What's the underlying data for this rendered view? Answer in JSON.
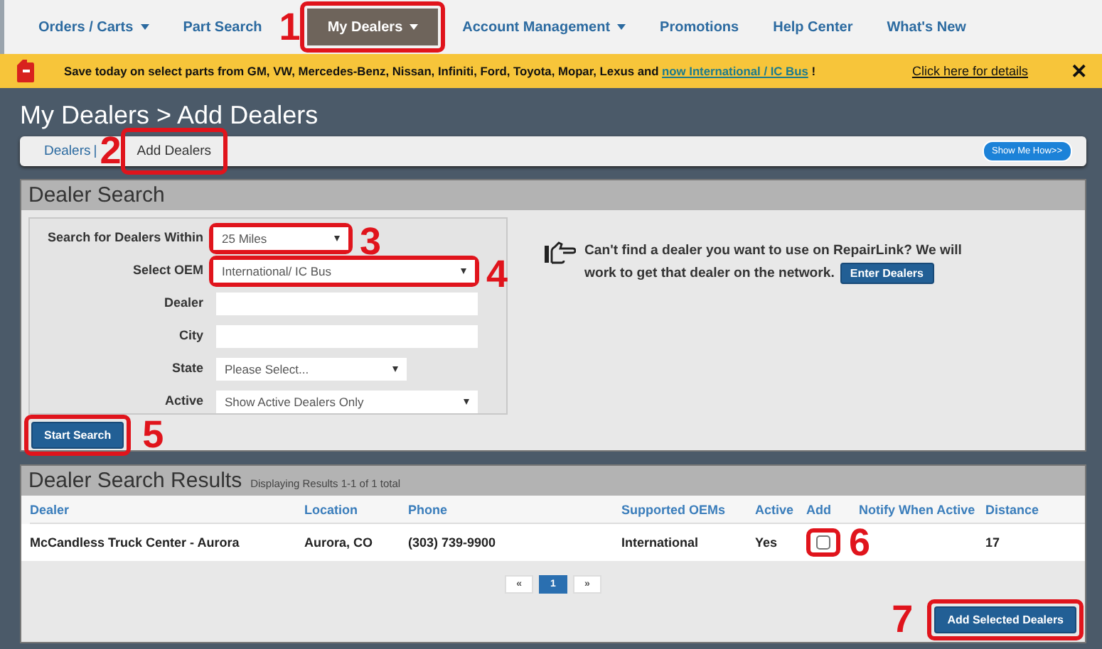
{
  "nav": {
    "items": [
      {
        "label": "Orders / Carts",
        "menu": true,
        "selected": false
      },
      {
        "label": "Part Search",
        "menu": false,
        "selected": false
      },
      {
        "label": "My Dealers",
        "menu": true,
        "selected": true,
        "callout": "1"
      },
      {
        "label": "Account Management",
        "menu": true,
        "selected": false
      },
      {
        "label": "Promotions",
        "menu": false,
        "selected": false
      },
      {
        "label": "Help Center",
        "menu": false,
        "selected": false
      },
      {
        "label": "What's New",
        "menu": false,
        "selected": false
      }
    ]
  },
  "banner": {
    "text": "Save today on select parts from GM, VW, Mercedes-Benz, Nissan, Infiniti, Ford, Toyota, Mopar, Lexus and ",
    "link": "now International / IC Bus",
    "text_after": " !",
    "details_link": "Click here for details",
    "close": "✕"
  },
  "page_title": "My Dealers > Add Dealers",
  "breadcrumb": {
    "items": [
      {
        "label": "Dealers",
        "separator": "|"
      },
      {
        "label": "Add Dealers",
        "callout": "2"
      }
    ],
    "help_button": "Show Me How>>"
  },
  "dealer_search": {
    "title": "Dealer Search",
    "fields": [
      {
        "label": "Search for Dealers Within",
        "kind": "select",
        "value": "25 Miles",
        "callout": "3"
      },
      {
        "label": "Select OEM",
        "kind": "select",
        "value": "International/ IC Bus",
        "callout": "4"
      },
      {
        "label": "Dealer",
        "kind": "text"
      },
      {
        "label": "City",
        "kind": "text"
      },
      {
        "label": "State",
        "kind": "select",
        "value": "Please Select..."
      },
      {
        "label": "Active",
        "kind": "select",
        "value": "Show Active Dealers Only"
      }
    ],
    "hint": "Can't find a dealer you want to use on RepairLink? We will work to get that dealer on the network.",
    "enter_button": "Enter Dealers",
    "search_button": {
      "label": "Start Search",
      "callout": "5"
    }
  },
  "results": {
    "title": "Dealer Search Results",
    "summary": "Displaying Results 1-1 of 1 total",
    "columns": [
      "Dealer",
      "Location",
      "Phone",
      "Supported OEMs",
      "Active",
      "Add",
      "Notify When Active",
      "Distance"
    ],
    "rows": [
      {
        "dealer": "McCandless Truck Center - Aurora",
        "location": "Aurora, CO",
        "phone": "(303) 739-9900",
        "oems": "International",
        "active": "Yes",
        "add_checked": false,
        "add_callout": "6",
        "distance": "17"
      }
    ],
    "pagination": {
      "prev": "«",
      "pages": [
        {
          "label": "1",
          "selected": true
        }
      ],
      "next": "»"
    },
    "add_button": {
      "label": "Add Selected Dealers",
      "callout": "7"
    }
  }
}
